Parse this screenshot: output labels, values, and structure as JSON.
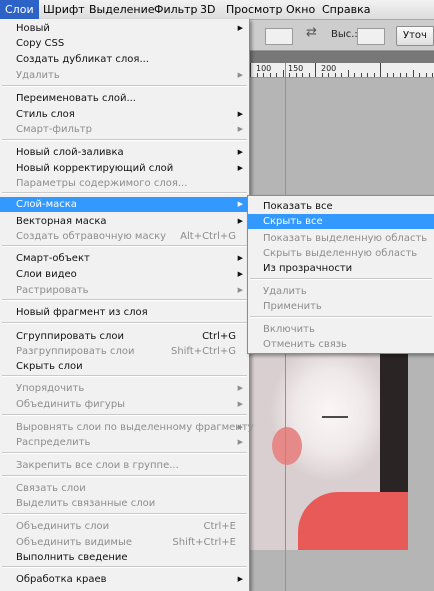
{
  "menubar": [
    "Слои",
    "Шрифт",
    "Выделение",
    "Фильтр",
    "3D",
    "Просмотр",
    "Окно",
    "Справка"
  ],
  "options": {
    "height_label": "Выс.:",
    "button": "Уточ"
  },
  "ruler": [
    "100",
    "150",
    "200"
  ],
  "menu": [
    {
      "label": "Новый",
      "arrow": true
    },
    {
      "label": "Copy CSS"
    },
    {
      "label": "Создать дубликат слоя..."
    },
    {
      "label": "Удалить",
      "disabled": true,
      "arrow": true
    },
    {
      "label": "Переименовать слой..."
    },
    {
      "label": "Стиль слоя",
      "arrow": true
    },
    {
      "label": "Смарт-фильтр",
      "disabled": true,
      "arrow": true
    },
    {
      "label": "Новый слой-заливка",
      "arrow": true
    },
    {
      "label": "Новый корректирующий слой",
      "arrow": true
    },
    {
      "label": "Параметры содержимого слоя...",
      "disabled": true
    },
    {
      "label": "Слой-маска",
      "arrow": true,
      "highlight": true
    },
    {
      "label": "Векторная маска",
      "arrow": true
    },
    {
      "label": "Создать обтравочную маску",
      "disabled": true,
      "shortcut": "Alt+Ctrl+G"
    },
    {
      "label": "Смарт-объект",
      "arrow": true
    },
    {
      "label": "Слои видео",
      "arrow": true
    },
    {
      "label": "Растрировать",
      "disabled": true,
      "arrow": true
    },
    {
      "label": "Новый фрагмент из слоя"
    },
    {
      "label": "Сгруппировать слои",
      "shortcut": "Ctrl+G"
    },
    {
      "label": "Разгруппировать слои",
      "disabled": true,
      "shortcut": "Shift+Ctrl+G"
    },
    {
      "label": "Скрыть слои"
    },
    {
      "label": "Упорядочить",
      "disabled": true,
      "arrow": true
    },
    {
      "label": "Объединить фигуры",
      "disabled": true,
      "arrow": true
    },
    {
      "label": "Выровнять слои по выделенному фрагменту",
      "disabled": true,
      "arrow": true
    },
    {
      "label": "Распределить",
      "disabled": true,
      "arrow": true
    },
    {
      "label": "Закрепить все слои в группе...",
      "disabled": true
    },
    {
      "label": "Связать слои",
      "disabled": true
    },
    {
      "label": "Выделить связанные слои",
      "disabled": true
    },
    {
      "label": "Объединить слои",
      "disabled": true,
      "shortcut": "Ctrl+E"
    },
    {
      "label": "Объединить видимые",
      "disabled": true,
      "shortcut": "Shift+Ctrl+E"
    },
    {
      "label": "Выполнить сведение"
    },
    {
      "label": "Обработка краев",
      "arrow": true
    }
  ],
  "submenu": [
    {
      "label": "Показать все"
    },
    {
      "label": "Скрыть все",
      "highlight": true
    },
    {
      "label": "Показать выделенную область",
      "disabled": true
    },
    {
      "label": "Скрыть выделенную область",
      "disabled": true
    },
    {
      "label": "Из прозрачности"
    },
    {
      "label": "Удалить",
      "disabled": true
    },
    {
      "label": "Применить",
      "disabled": true
    },
    {
      "label": "Включить",
      "disabled": true
    },
    {
      "label": "Отменить связь",
      "disabled": true
    }
  ]
}
